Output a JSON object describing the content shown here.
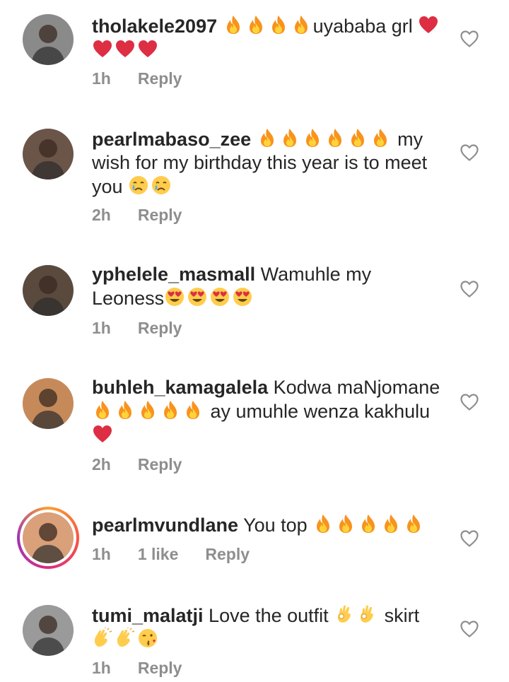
{
  "comments": [
    {
      "username": "tholakele2097",
      "segments": [
        {
          "emoji": "fire"
        },
        {
          "emoji": "fire"
        },
        {
          "emoji": "fire"
        },
        {
          "emoji": "fire"
        },
        {
          "text": "uyababa grl "
        },
        {
          "emoji": "red-heart"
        },
        {
          "emoji": "red-heart"
        },
        {
          "emoji": "red-heart"
        },
        {
          "emoji": "red-heart"
        }
      ],
      "time": "1h",
      "likes": "",
      "reply": "Reply",
      "avatar_color": "#8a8a8a"
    },
    {
      "username": "pearlmabaso_zee",
      "segments": [
        {
          "emoji": "fire"
        },
        {
          "emoji": "fire"
        },
        {
          "emoji": "fire"
        },
        {
          "emoji": "fire"
        },
        {
          "emoji": "fire"
        },
        {
          "emoji": "fire"
        },
        {
          "text": " my wish for my birthday this year is to meet you "
        },
        {
          "emoji": "crying-face"
        },
        {
          "emoji": "crying-face"
        }
      ],
      "time": "2h",
      "likes": "",
      "reply": "Reply",
      "avatar_color": "#6b5448"
    },
    {
      "username": "yphelele_masmall",
      "segments": [
        {
          "text": " Wamuhle my Leoness"
        },
        {
          "emoji": "heart-eyes"
        },
        {
          "emoji": "heart-eyes"
        },
        {
          "emoji": "heart-eyes"
        },
        {
          "emoji": "heart-eyes"
        }
      ],
      "time": "1h",
      "likes": "",
      "reply": "Reply",
      "avatar_color": "#5a4a3e"
    },
    {
      "username": "buhleh_kamagalela",
      "segments": [
        {
          "text": " Kodwa maNjomane "
        },
        {
          "emoji": "fire"
        },
        {
          "emoji": "fire"
        },
        {
          "emoji": "fire"
        },
        {
          "emoji": "fire"
        },
        {
          "emoji": "fire"
        },
        {
          "text": " ay umuhle wenza kakhulu "
        },
        {
          "emoji": "red-heart"
        }
      ],
      "time": "2h",
      "likes": "",
      "reply": "Reply",
      "avatar_color": "#c68a5a"
    },
    {
      "username": "pearlmvundlane",
      "segments": [
        {
          "text": " You top "
        },
        {
          "emoji": "fire"
        },
        {
          "emoji": "fire"
        },
        {
          "emoji": "fire"
        },
        {
          "emoji": "fire"
        },
        {
          "emoji": "fire"
        }
      ],
      "time": "1h",
      "likes": "1 like",
      "reply": "Reply",
      "avatar_color": "#d9a07a",
      "story_ring": true
    },
    {
      "username": "tumi_malatji",
      "segments": [
        {
          "text": " Love the outfit "
        },
        {
          "emoji": "ok-hand"
        },
        {
          "emoji": "ok-hand"
        },
        {
          "text": " skirt "
        },
        {
          "emoji": "clapping-hands"
        },
        {
          "emoji": "clapping-hands"
        },
        {
          "emoji": "kissing-face"
        }
      ],
      "time": "1h",
      "likes": "",
      "reply": "Reply",
      "avatar_color": "#9a9a9a"
    }
  ],
  "colors": {
    "text": "#262626",
    "meta": "#8e8e8e",
    "fire": "#f7931e",
    "heart": "#dd2e44",
    "emoji_face": "#ffcc4d"
  },
  "icons": {
    "like": "heart-outline-icon"
  }
}
